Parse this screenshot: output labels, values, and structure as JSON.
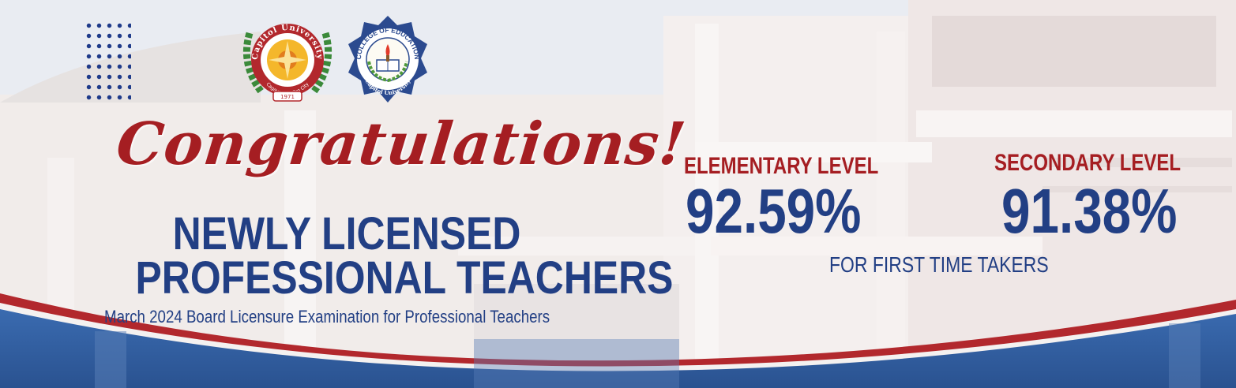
{
  "logos": {
    "university_ring_text": "Capitol University",
    "university_city_text": "Cagayan de Oro City",
    "university_year": "1971",
    "college_ring_text": "COLLEGE OF EDUCATION",
    "college_bottom_text": "Capitol University"
  },
  "banner": {
    "congratulations": "Congratulations!",
    "headline_line1": "NEWLY LICENSED",
    "headline_line2": "PROFESSIONAL TEACHERS",
    "subheadline": "March 2024 Board Licensure Examination for Professional Teachers"
  },
  "results": [
    {
      "level": "ELEMENTARY LEVEL",
      "rate": "92.59%"
    },
    {
      "level": "SECONDARY LEVEL",
      "rate": "91.38%"
    }
  ],
  "results_note": "FOR FIRST TIME TAKERS",
  "colors": {
    "red": "#a51e22",
    "navy": "#223f84",
    "wave_blue": "#2f5d9f"
  }
}
